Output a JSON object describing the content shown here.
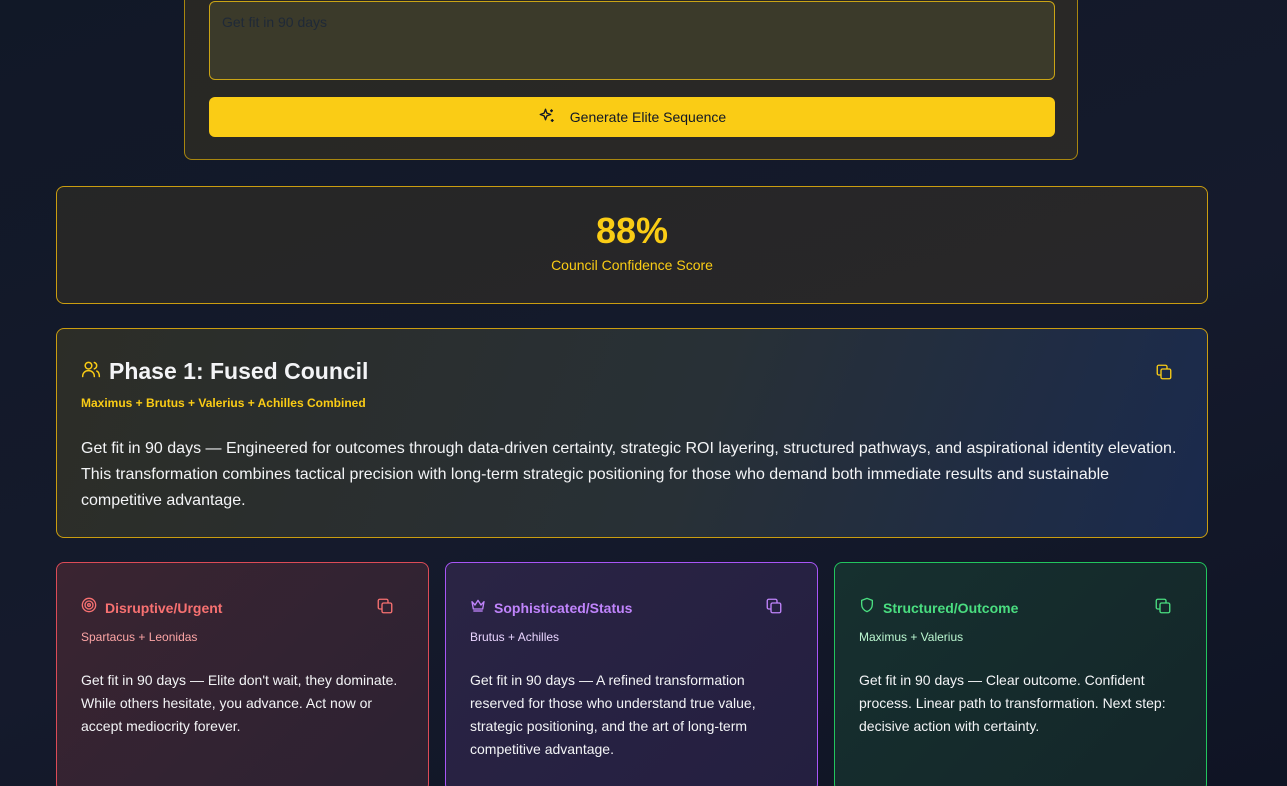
{
  "input": {
    "goal_value": "Get fit in 90 days",
    "generate_label": "Generate Elite Sequence"
  },
  "score": {
    "value": "88%",
    "label": "Council Confidence Score"
  },
  "phase": {
    "title": "Phase 1: Fused Council",
    "subtitle": "Maximus + Brutus + Valerius + Achilles Combined",
    "body": "Get fit in 90 days — Engineered for outcomes through data-driven certainty, strategic ROI layering, structured pathways, and aspirational identity elevation. This transformation combines tactical precision with long-term strategic positioning for those who demand both immediate results and sustainable competitive advantage."
  },
  "variants": [
    {
      "title": "Disruptive/Urgent",
      "subtitle": "Spartacus + Leonidas",
      "body": "Get fit in 90 days — Elite don't wait, they dominate. While others hesitate, you advance. Act now or accept mediocrity forever.",
      "icon": "target-icon",
      "color": "#f87171"
    },
    {
      "title": "Sophisticated/Status",
      "subtitle": "Brutus + Achilles",
      "body": "Get fit in 90 days — A refined transformation reserved for those who understand true value, strategic positioning, and the art of long-term competitive advantage.",
      "icon": "crown-icon",
      "color": "#c084fc"
    },
    {
      "title": "Structured/Outcome",
      "subtitle": "Maximus + Valerius",
      "body": "Get fit in 90 days — Clear outcome. Confident process. Linear path to transformation. Next step: decisive action with certainty.",
      "icon": "shield-icon",
      "color": "#4ade80"
    }
  ],
  "colors": {
    "accent": "#facc15",
    "background": "#111827"
  }
}
